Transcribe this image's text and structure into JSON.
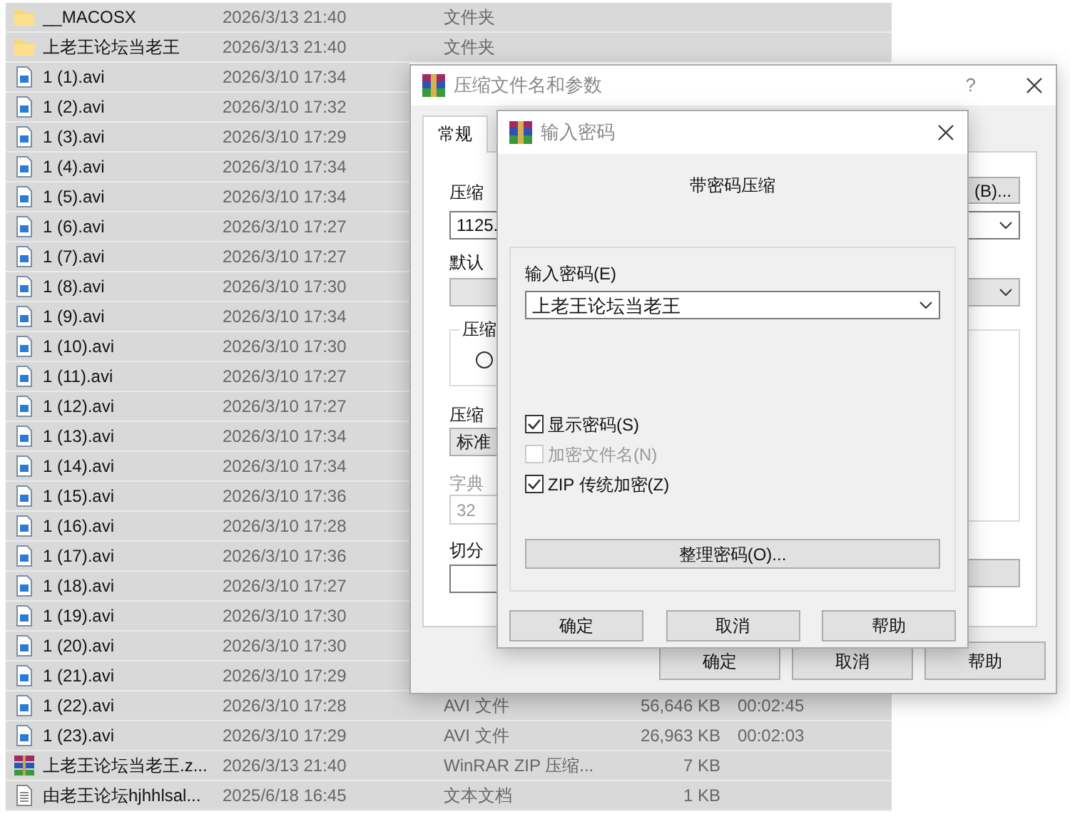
{
  "files": [
    {
      "kind": "folder",
      "name": "__MACOSX",
      "date": "2026/3/13 21:40",
      "type": "文件夹",
      "selected": true
    },
    {
      "kind": "folder",
      "name": "上老王论坛当老王",
      "date": "2026/3/13 21:40",
      "type": "文件夹",
      "selected": true
    },
    {
      "kind": "video",
      "name": "1 (1).avi",
      "date": "2026/3/10 17:34",
      "selected": true
    },
    {
      "kind": "video",
      "name": "1 (2).avi",
      "date": "2026/3/10 17:32",
      "selected": true
    },
    {
      "kind": "video",
      "name": "1 (3).avi",
      "date": "2026/3/10 17:29",
      "selected": true
    },
    {
      "kind": "video",
      "name": "1 (4).avi",
      "date": "2026/3/10 17:34",
      "selected": true
    },
    {
      "kind": "video",
      "name": "1 (5).avi",
      "date": "2026/3/10 17:34",
      "selected": true
    },
    {
      "kind": "video",
      "name": "1 (6).avi",
      "date": "2026/3/10 17:27",
      "selected": true
    },
    {
      "kind": "video",
      "name": "1 (7).avi",
      "date": "2026/3/10 17:27",
      "selected": true
    },
    {
      "kind": "video",
      "name": "1 (8).avi",
      "date": "2026/3/10 17:30",
      "selected": true
    },
    {
      "kind": "video",
      "name": "1 (9).avi",
      "date": "2026/3/10 17:34",
      "selected": true
    },
    {
      "kind": "video",
      "name": "1 (10).avi",
      "date": "2026/3/10 17:30",
      "selected": true
    },
    {
      "kind": "video",
      "name": "1 (11).avi",
      "date": "2026/3/10 17:27",
      "selected": true
    },
    {
      "kind": "video",
      "name": "1 (12).avi",
      "date": "2026/3/10 17:27",
      "selected": true
    },
    {
      "kind": "video",
      "name": "1 (13).avi",
      "date": "2026/3/10 17:34",
      "selected": true
    },
    {
      "kind": "video",
      "name": "1 (14).avi",
      "date": "2026/3/10 17:34",
      "selected": true
    },
    {
      "kind": "video",
      "name": "1 (15).avi",
      "date": "2026/3/10 17:36",
      "selected": true
    },
    {
      "kind": "video",
      "name": "1 (16).avi",
      "date": "2026/3/10 17:28",
      "selected": true
    },
    {
      "kind": "video",
      "name": "1 (17).avi",
      "date": "2026/3/10 17:36",
      "selected": true
    },
    {
      "kind": "video",
      "name": "1 (18).avi",
      "date": "2026/3/10 17:27",
      "selected": true
    },
    {
      "kind": "video",
      "name": "1 (19).avi",
      "date": "2026/3/10 17:30",
      "selected": true
    },
    {
      "kind": "video",
      "name": "1 (20).avi",
      "date": "2026/3/10 17:30",
      "selected": true
    },
    {
      "kind": "video",
      "name": "1 (21).avi",
      "date": "2026/3/10 17:29",
      "selected": true
    },
    {
      "kind": "video",
      "name": "1 (22).avi",
      "date": "2026/3/10 17:28",
      "type": "AVI 文件",
      "size": "56,646 KB",
      "duration": "00:02:45",
      "selected": true
    },
    {
      "kind": "video",
      "name": "1 (23).avi",
      "date": "2026/3/10 17:29",
      "type": "AVI 文件",
      "size": "26,963 KB",
      "duration": "00:02:03",
      "selected": true
    },
    {
      "kind": "archive",
      "name": "上老王论坛当老王.z...",
      "date": "2026/3/13 21:40",
      "type": "WinRAR ZIP 压缩...",
      "size": "7 KB",
      "selected": true
    },
    {
      "kind": "text",
      "name": "由老王论坛hjhhlsal...",
      "date": "2025/6/18 16:45",
      "type": "文本文档",
      "size": "1 KB",
      "selected": true
    }
  ],
  "archive_dialog": {
    "title": "压缩文件名和参数",
    "help": "?",
    "tabs": [
      {
        "label": "常规",
        "selected": true
      }
    ],
    "archive_name_label": "压缩",
    "browse_button": "(B)...",
    "archive_name_value": "1125.",
    "profile_label": "默认",
    "format_group_label": "压缩",
    "format_radio": {
      "selected": false
    },
    "method_label": "压缩",
    "method_value": "标准",
    "dictionary_label": "字典",
    "dictionary_value": "32",
    "dictionary_disabled": true,
    "split_label": "切分",
    "buttons": [
      "确定",
      "取消",
      "帮助"
    ]
  },
  "password_dialog": {
    "title": "输入密码",
    "heading": "带密码压缩",
    "password_label": "输入密码(E)",
    "password_value": "上老王论坛当老王",
    "options": [
      {
        "label": "显示密码(S)",
        "checked": true,
        "disabled": false
      },
      {
        "label": "加密文件名(N)",
        "checked": false,
        "disabled": true
      },
      {
        "label": "ZIP 传统加密(Z)",
        "checked": true,
        "disabled": false
      }
    ],
    "organize_button": "整理密码(O)...",
    "buttons": [
      "确定",
      "取消",
      "帮助"
    ]
  }
}
